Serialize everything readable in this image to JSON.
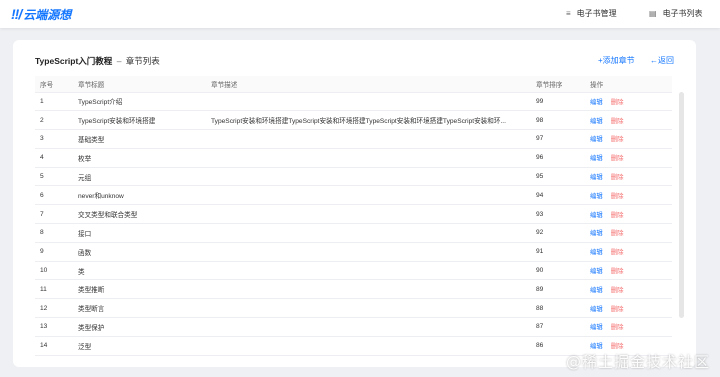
{
  "header": {
    "logo_mark": "!!/",
    "logo_text": "云端源想",
    "nav": [
      {
        "icon": "list-icon",
        "glyph": "≡",
        "label": "电子书管理"
      },
      {
        "icon": "book-icon",
        "glyph": "▤",
        "label": "电子书列表"
      }
    ]
  },
  "card": {
    "title_main": "TypeScript入门教程",
    "title_sep": "–",
    "title_sub": "章节列表",
    "add_label": "+添加章节",
    "back_label": "←返回"
  },
  "table": {
    "columns": [
      "序号",
      "章节标题",
      "章节描述",
      "章节排序",
      "操作"
    ],
    "rows": [
      {
        "no": "1",
        "title": "TypeScript介绍",
        "desc": "",
        "order": "99"
      },
      {
        "no": "2",
        "title": "TypeScript安装和环境搭建",
        "desc": "TypeScript安装和环境搭建TypeScript安装和环境搭建TypeScript安装和环境搭建TypeScript安装和环...",
        "order": "98"
      },
      {
        "no": "3",
        "title": "基础类型",
        "desc": "",
        "order": "97"
      },
      {
        "no": "4",
        "title": "枚举",
        "desc": "",
        "order": "96"
      },
      {
        "no": "5",
        "title": "元组",
        "desc": "",
        "order": "95"
      },
      {
        "no": "6",
        "title": "never和unknow",
        "desc": "",
        "order": "94"
      },
      {
        "no": "7",
        "title": "交叉类型和联合类型",
        "desc": "",
        "order": "93"
      },
      {
        "no": "8",
        "title": "接口",
        "desc": "",
        "order": "92"
      },
      {
        "no": "9",
        "title": "函数",
        "desc": "",
        "order": "91"
      },
      {
        "no": "10",
        "title": "类",
        "desc": "",
        "order": "90"
      },
      {
        "no": "11",
        "title": "类型推断",
        "desc": "",
        "order": "89"
      },
      {
        "no": "12",
        "title": "类型断言",
        "desc": "",
        "order": "88"
      },
      {
        "no": "13",
        "title": "类型保护",
        "desc": "",
        "order": "87"
      },
      {
        "no": "14",
        "title": "泛型",
        "desc": "",
        "order": "86"
      }
    ],
    "edit_label": "编辑",
    "delete_label": "删除"
  },
  "watermark": "@稀土掘金技术社区"
}
